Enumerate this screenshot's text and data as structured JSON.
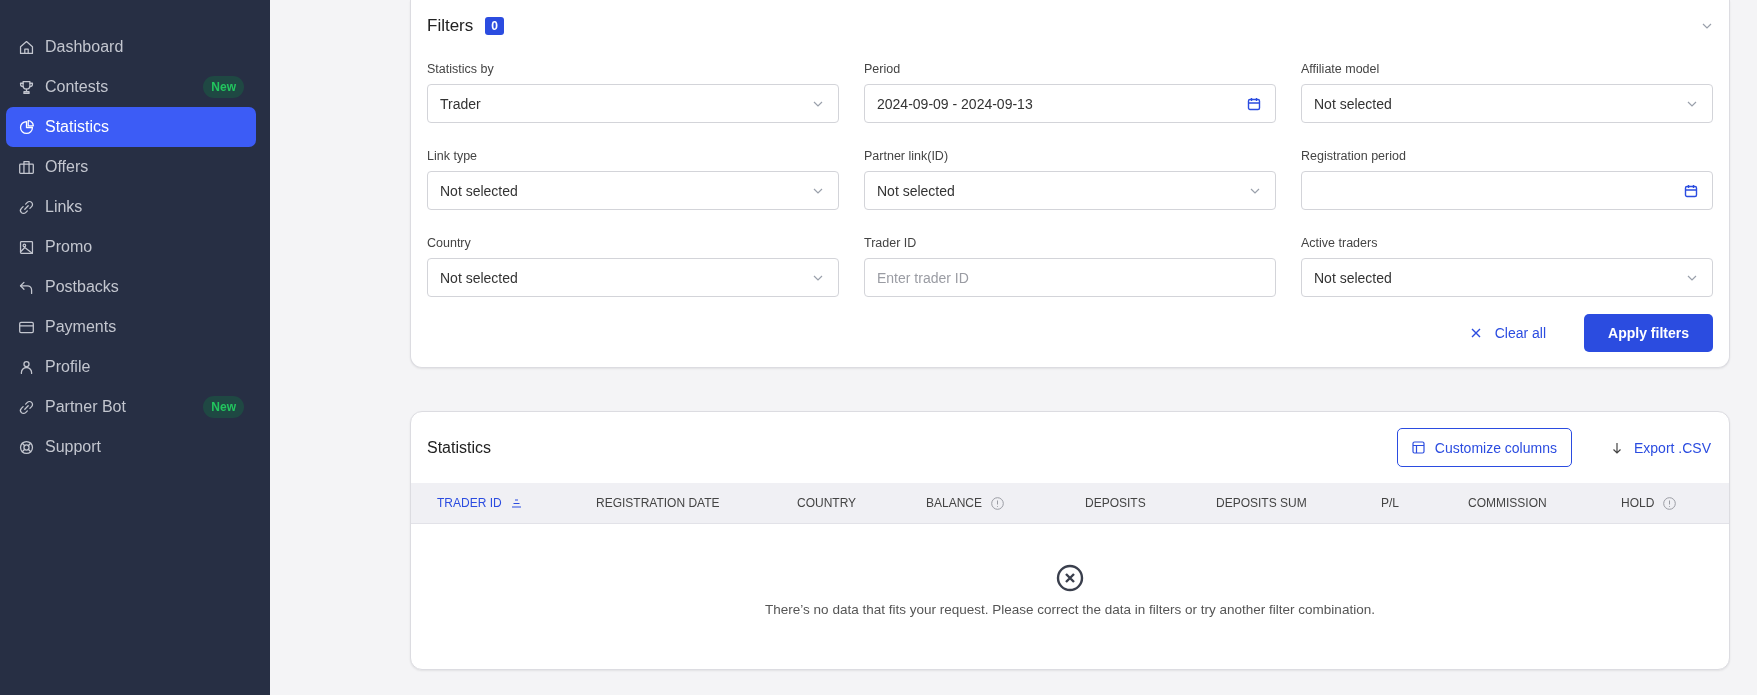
{
  "sidebar": {
    "items": [
      {
        "label": "Dashboard",
        "selected": false
      },
      {
        "label": "Contests",
        "selected": false,
        "badge": "New"
      },
      {
        "label": "Statistics",
        "selected": true
      },
      {
        "label": "Offers",
        "selected": false
      },
      {
        "label": "Links",
        "selected": false
      },
      {
        "label": "Promo",
        "selected": false
      },
      {
        "label": "Postbacks",
        "selected": false
      },
      {
        "label": "Payments",
        "selected": false
      },
      {
        "label": "Profile",
        "selected": false
      },
      {
        "label": "Partner Bot",
        "selected": false,
        "badge": "New"
      },
      {
        "label": "Support",
        "selected": false
      }
    ]
  },
  "filters": {
    "title": "Filters",
    "count": "0",
    "fields": [
      {
        "label": "Statistics by",
        "kind": "select",
        "value": "Trader"
      },
      {
        "label": "Period",
        "kind": "date",
        "value": "2024-09-09 - 2024-09-13"
      },
      {
        "label": "Affiliate model",
        "kind": "select",
        "value": "Not selected"
      },
      {
        "label": "Link type",
        "kind": "select",
        "value": "Not selected"
      },
      {
        "label": "Partner link(ID)",
        "kind": "select",
        "value": "Not selected"
      },
      {
        "label": "Registration period",
        "kind": "date"
      },
      {
        "label": "Country",
        "kind": "select",
        "value": "Not selected"
      },
      {
        "label": "Trader ID",
        "kind": "text",
        "placeholder": "Enter trader ID"
      },
      {
        "label": "Active traders",
        "kind": "select",
        "value": "Not selected"
      }
    ],
    "clear_button": "Clear all",
    "apply_button": "Apply filters"
  },
  "statistics": {
    "title": "Statistics",
    "customize_button": "Customize columns",
    "export_button": "Export .CSV",
    "columns": [
      {
        "label": "TRADER ID",
        "sorted": true,
        "info": false
      },
      {
        "label": "REGISTRATION DATE",
        "sorted": false,
        "info": false
      },
      {
        "label": "COUNTRY",
        "sorted": false,
        "info": false
      },
      {
        "label": "BALANCE",
        "sorted": false,
        "info": true
      },
      {
        "label": "DEPOSITS",
        "sorted": false,
        "info": false
      },
      {
        "label": "DEPOSITS SUM",
        "sorted": false,
        "info": false
      },
      {
        "label": "P/L",
        "sorted": false,
        "info": false
      },
      {
        "label": "COMMISSION",
        "sorted": false,
        "info": false
      },
      {
        "label": "HOLD",
        "sorted": false,
        "info": true
      }
    ],
    "empty_message": "There’s no data that fits your request. Please correct the data in filters or try another filter combination."
  }
}
